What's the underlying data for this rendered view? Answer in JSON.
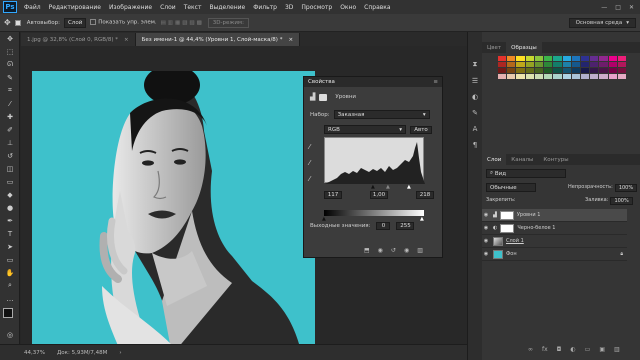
{
  "menu": {
    "logo": "Ps",
    "items": [
      "Файл",
      "Редактирование",
      "Изображение",
      "Слои",
      "Текст",
      "Выделение",
      "Фильтр",
      "3D",
      "Просмотр",
      "Окно",
      "Справка"
    ],
    "window_controls": [
      "—",
      "□",
      "✕"
    ]
  },
  "options": {
    "autoselect_label": "Автовыбор:",
    "autoselect_value": "Слой",
    "transform_label": "Показать упр. элем.",
    "mode_3d": "3D-режим:",
    "workspace": "Основная среда"
  },
  "tabs": [
    {
      "label": "1.jpg @ 32,8% (Слой 0, RGB/8) *",
      "close": "×"
    },
    {
      "label": "Без имени-1 @ 44,4% (Уровни 1, Слой-маска/8) *",
      "close": "×"
    }
  ],
  "status": {
    "zoom": "44,37%",
    "doc": "Док: 5,93M/7,48M"
  },
  "properties": {
    "title": "Свойства",
    "collapse": "«",
    "menu": "≡",
    "adj_name": "Уровни",
    "preset_label": "Набор:",
    "preset_value": "Заказная",
    "channel": "RGB",
    "auto": "Авто",
    "input_black": "117",
    "input_mid": "1,00",
    "input_white": "218",
    "output_label": "Выходные значения:",
    "output_black": "0",
    "output_white": "255"
  },
  "right_panel": {
    "color_tabs": [
      "Цвет",
      "Образцы"
    ],
    "layer_tabs": [
      "Слои",
      "Каналы",
      "Контуры"
    ],
    "kind": "Вид",
    "blend": "Обычные",
    "opacity_label": "Непрозрачность:",
    "opacity": "100%",
    "lock_label": "Закрепить:",
    "fill_label": "Заливка:",
    "fill": "100%",
    "layers": [
      {
        "name": "Уровни 1",
        "type": "adjustment"
      },
      {
        "name": "Черно-белое 1",
        "type": "adjustment"
      },
      {
        "name": "Слой 1",
        "type": "image"
      },
      {
        "name": "Фон",
        "type": "background"
      }
    ]
  },
  "colors": {
    "canvas_bg": "#3ec1cb",
    "swatch_row": [
      "#e5322d",
      "#f08a24",
      "#ffe024",
      "#c7d92f",
      "#8cc63e",
      "#3cb54a",
      "#1ba68c",
      "#27aae1",
      "#1c75bc",
      "#2e3192",
      "#662d91",
      "#92278f",
      "#ec008c",
      "#ed1e79"
    ]
  }
}
